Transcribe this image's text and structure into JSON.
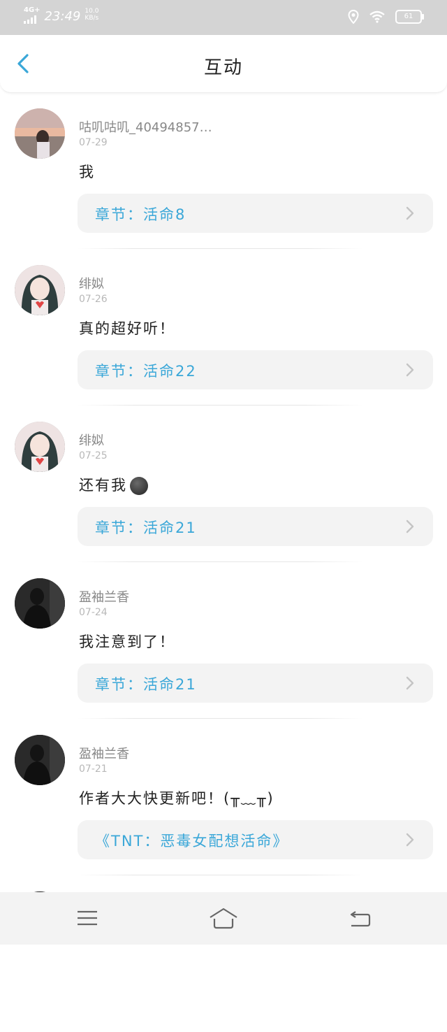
{
  "status_bar": {
    "network": "4G+",
    "time": "23:49",
    "speed_value": "10.0",
    "speed_unit": "KB/s",
    "battery": "61",
    "icons": [
      "signal-icon",
      "location-icon",
      "wifi-icon",
      "battery-icon"
    ]
  },
  "header": {
    "back_icon": "chevron-left-icon",
    "title": "互动"
  },
  "colors": {
    "accent": "#3aa7d8",
    "status_bar_bg": "#d4d4d4",
    "card_bg": "#f3f3f3"
  },
  "feed": {
    "items": [
      {
        "username": "咕叽咕叽_40494857…",
        "date": "07-29",
        "comment": "我",
        "link": "章节：活命8",
        "avatar": "sunset-avatar"
      },
      {
        "username": "绯姒",
        "date": "07-26",
        "comment": "真的超好听！",
        "link": "章节：活命22",
        "avatar": "girl-avatar"
      },
      {
        "username": "绯姒",
        "date": "07-25",
        "comment": "还有我",
        "link": "章节：活命21",
        "avatar": "girl-avatar",
        "emoji": "dark-smiley-emoji"
      },
      {
        "username": "盈袖兰香",
        "date": "07-24",
        "comment": "我注意到了！",
        "link": "章节：活命21",
        "avatar": "silhouette-avatar"
      },
      {
        "username": "盈袖兰香",
        "date": "07-21",
        "comment": "作者大大快更新吧！(╥﹏╥)",
        "link": "《TNT：恶毒女配想活命》",
        "avatar": "silhouette-avatar"
      }
    ]
  },
  "nav_bar": {
    "icons": [
      "menu-icon",
      "home-icon",
      "back-icon"
    ]
  }
}
